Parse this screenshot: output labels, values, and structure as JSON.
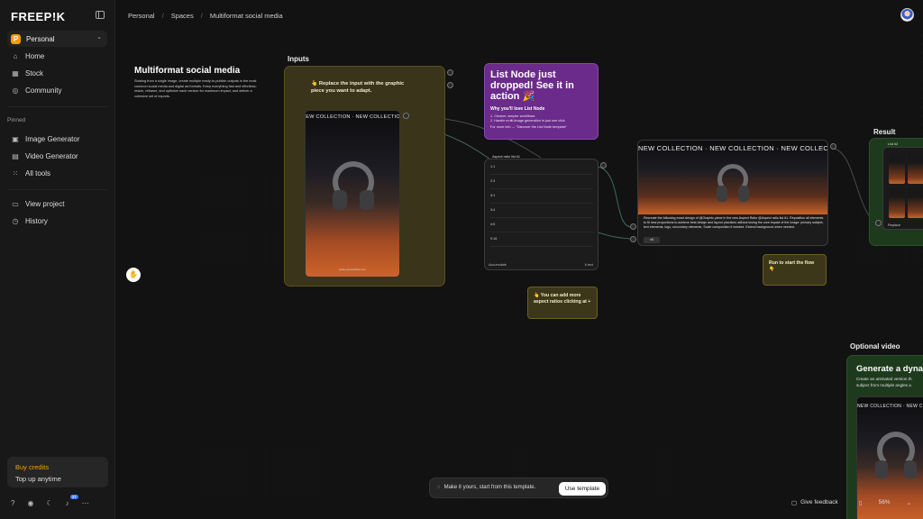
{
  "app": {
    "logo": "FREEP!K"
  },
  "sidebar": {
    "workspace": {
      "badge": "P",
      "label": "Personal"
    },
    "nav": [
      {
        "label": "Home",
        "icon": "home-icon"
      },
      {
        "label": "Stock",
        "icon": "stock-icon"
      },
      {
        "label": "Community",
        "icon": "globe-icon"
      }
    ],
    "pinned_label": "Pinned",
    "pinned": [
      {
        "label": "Image Generator",
        "icon": "image-icon"
      },
      {
        "label": "Video Generator",
        "icon": "video-icon"
      },
      {
        "label": "All tools",
        "icon": "grid-icon"
      }
    ],
    "project": [
      {
        "label": "View project",
        "icon": "folder-icon"
      },
      {
        "label": "History",
        "icon": "clock-icon"
      }
    ],
    "credits": {
      "title": "Buy credits",
      "subtitle": "Top up anytime"
    },
    "notification_count": "37"
  },
  "breadcrumb": [
    "Personal",
    "Spaces",
    "Multiformat social media"
  ],
  "canvas": {
    "title": "Multiformat social media",
    "description": "Starting from a single image, create multiple ready-to-publish outputs in the most common social media and digital ad formats. Keep everything fast and effortless: resize, reframe, and optimize each version for maximum impact, and deliver a cohesive set of exports.",
    "inputs_label": "Inputs",
    "inputs_note": "👆 Replace the input with the graphic piece you want to adapt.",
    "collection_text": "NEW COLLECTION · NEW COLLECTION · NEW COLLECTION",
    "input_footer": "www.yourwebsite.com",
    "list_node": {
      "title": "List Node just dropped! See it in action 🎉",
      "subtitle": "Why you'll love List Node",
      "points": [
        "1. Cleaner, simpler workflows",
        "2. Handle multi-image generation in just one click"
      ],
      "more": "For more info → \"Discover the List Node template\""
    },
    "aspect_node": {
      "header": "Aspect ratio list #1",
      "rows": [
        "1:1",
        "2:3",
        "3:1",
        "3:4",
        "4:5",
        "9:16"
      ],
      "footer_left": "Accumulate",
      "footer_right": "6 text"
    },
    "sticky_add": "👆 You can add more aspect ratios clicking at +",
    "sticky_run": "Run to start the flow 👇",
    "gen_node": {
      "prompt": "Recreate the following exact design of @Graphic piece in the new Aspect Ratio @Aspect ratio list #1. Reposition all elements to fit new proportions to achieve best design and layout practices without losing the core impact of the image: primary subject, text elements, logo, secondary elements. Scale composition if needed. Extend background when needed.",
      "chip": "x6"
    },
    "result_label": "Result",
    "result_inner_label": "List #2",
    "result_footer": "Replace",
    "optional_video_label": "Optional video",
    "video_title": "Generate a dynamic",
    "video_desc": "Create an animated version th\nsubject from multiple angles a"
  },
  "bottom_bar": {
    "template_text": "Make it yours, start from this template.",
    "use_template": "Use template",
    "feedback": "Give feedback",
    "zoom": "56%"
  }
}
